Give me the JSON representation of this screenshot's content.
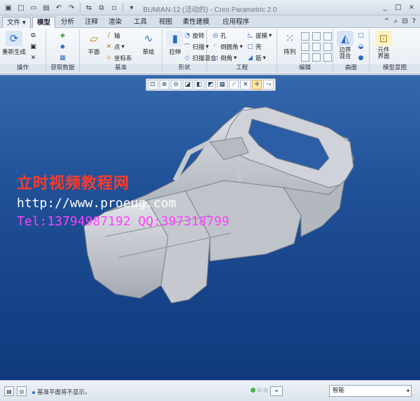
{
  "window": {
    "title": "BUMIAN-12 (活动的) - Creo Parametric 2.0",
    "controls": [
      "_",
      "□",
      "×"
    ]
  },
  "tabs": {
    "file": "文件",
    "items": [
      "模型",
      "分析",
      "注释",
      "渲染",
      "工具",
      "视图",
      "柔性建模",
      "应用程序"
    ],
    "active": "模型"
  },
  "ribbon": {
    "groups": {
      "operations": "操作",
      "get_data": "获取数据",
      "datum": "基准",
      "shapes": "形状",
      "engineering": "工程",
      "editing": "编辑",
      "surfaces": "曲面",
      "model_intent": "模型意图"
    },
    "buttons": {
      "regenerate": "重新生成",
      "plane": "平面",
      "axis": "轴",
      "point": "点",
      "csys": "坐标系",
      "sketch": "草绘",
      "extrude": "拉伸",
      "revolve": "旋转",
      "sweep": "扫描",
      "swept_blend": "扫描混合",
      "hole": "孔",
      "round": "倒圆角",
      "chamfer": "倒角",
      "draft": "拔模",
      "shell": "壳",
      "rib": "筋",
      "pattern": "阵列",
      "boundary_blend": "边界\n混合",
      "component_interface": "元件\n界面"
    }
  },
  "watermark": {
    "line1": "立时视频教程网",
    "line2": "http://www.proeug.com",
    "line3": "Tel:13794987192  QQ:397318799"
  },
  "status": {
    "message": "基准平面将不显示。",
    "filter": "智能"
  },
  "colors": {
    "graphics_top": "#3468ad",
    "graphics_bottom": "#0f3a7e",
    "model": "#c9cdd3",
    "watermark_red": "#ff3a2a",
    "watermark_magenta": "#ff41ff"
  }
}
